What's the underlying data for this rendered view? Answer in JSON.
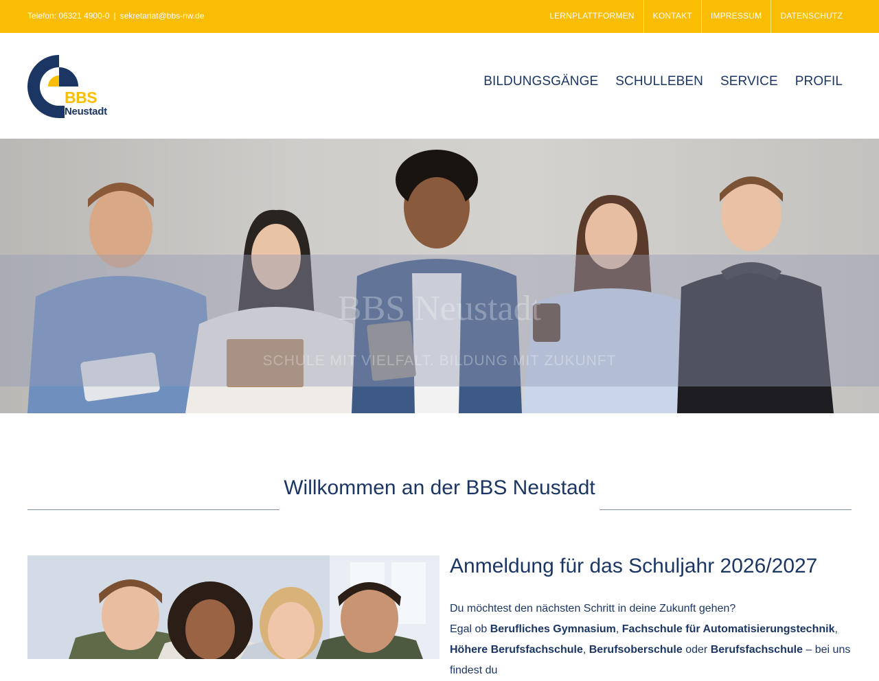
{
  "topbar": {
    "phone": "Telefon: 06321 4900-0",
    "separator": "|",
    "email": "sekretariat@bbs-nw.de",
    "links": [
      "LERNPLATTFORMEN",
      "KONTAKT",
      "IMPRESSUM",
      "DATENSCHUTZ"
    ]
  },
  "logo": {
    "line1": "BBS",
    "line2": "Neustadt"
  },
  "nav": [
    "BILDUNGSGÄNGE",
    "SCHULLEBEN",
    "SERVICE",
    "PROFIL"
  ],
  "hero": {
    "title": "BBS Neustadt",
    "subtitle": "SCHULE MIT VIELFALT. BILDUNG MIT ZUKUNFT"
  },
  "welcome": {
    "heading": "Willkommen an der BBS Neustadt"
  },
  "article": {
    "heading": "Anmeldung für das Schuljahr 2026/2027",
    "intro": "Du möchtest den nächsten Schritt in deine Zukunft gehen?",
    "t1": "Egal ob ",
    "b1": "Berufliches Gymnasium",
    "t2": ", ",
    "b2": "Fachschule für Automatisierungstechnik",
    "t3": ", ",
    "b3": "Höhere Berufsfachschule",
    "t4": ", ",
    "b4": "Berufsoberschule",
    "t5": " oder ",
    "b5": "Berufsfachschule",
    "t6": " – bei uns findest du"
  },
  "colors": {
    "accent": "#fbbd02",
    "brand": "#1c3664"
  }
}
